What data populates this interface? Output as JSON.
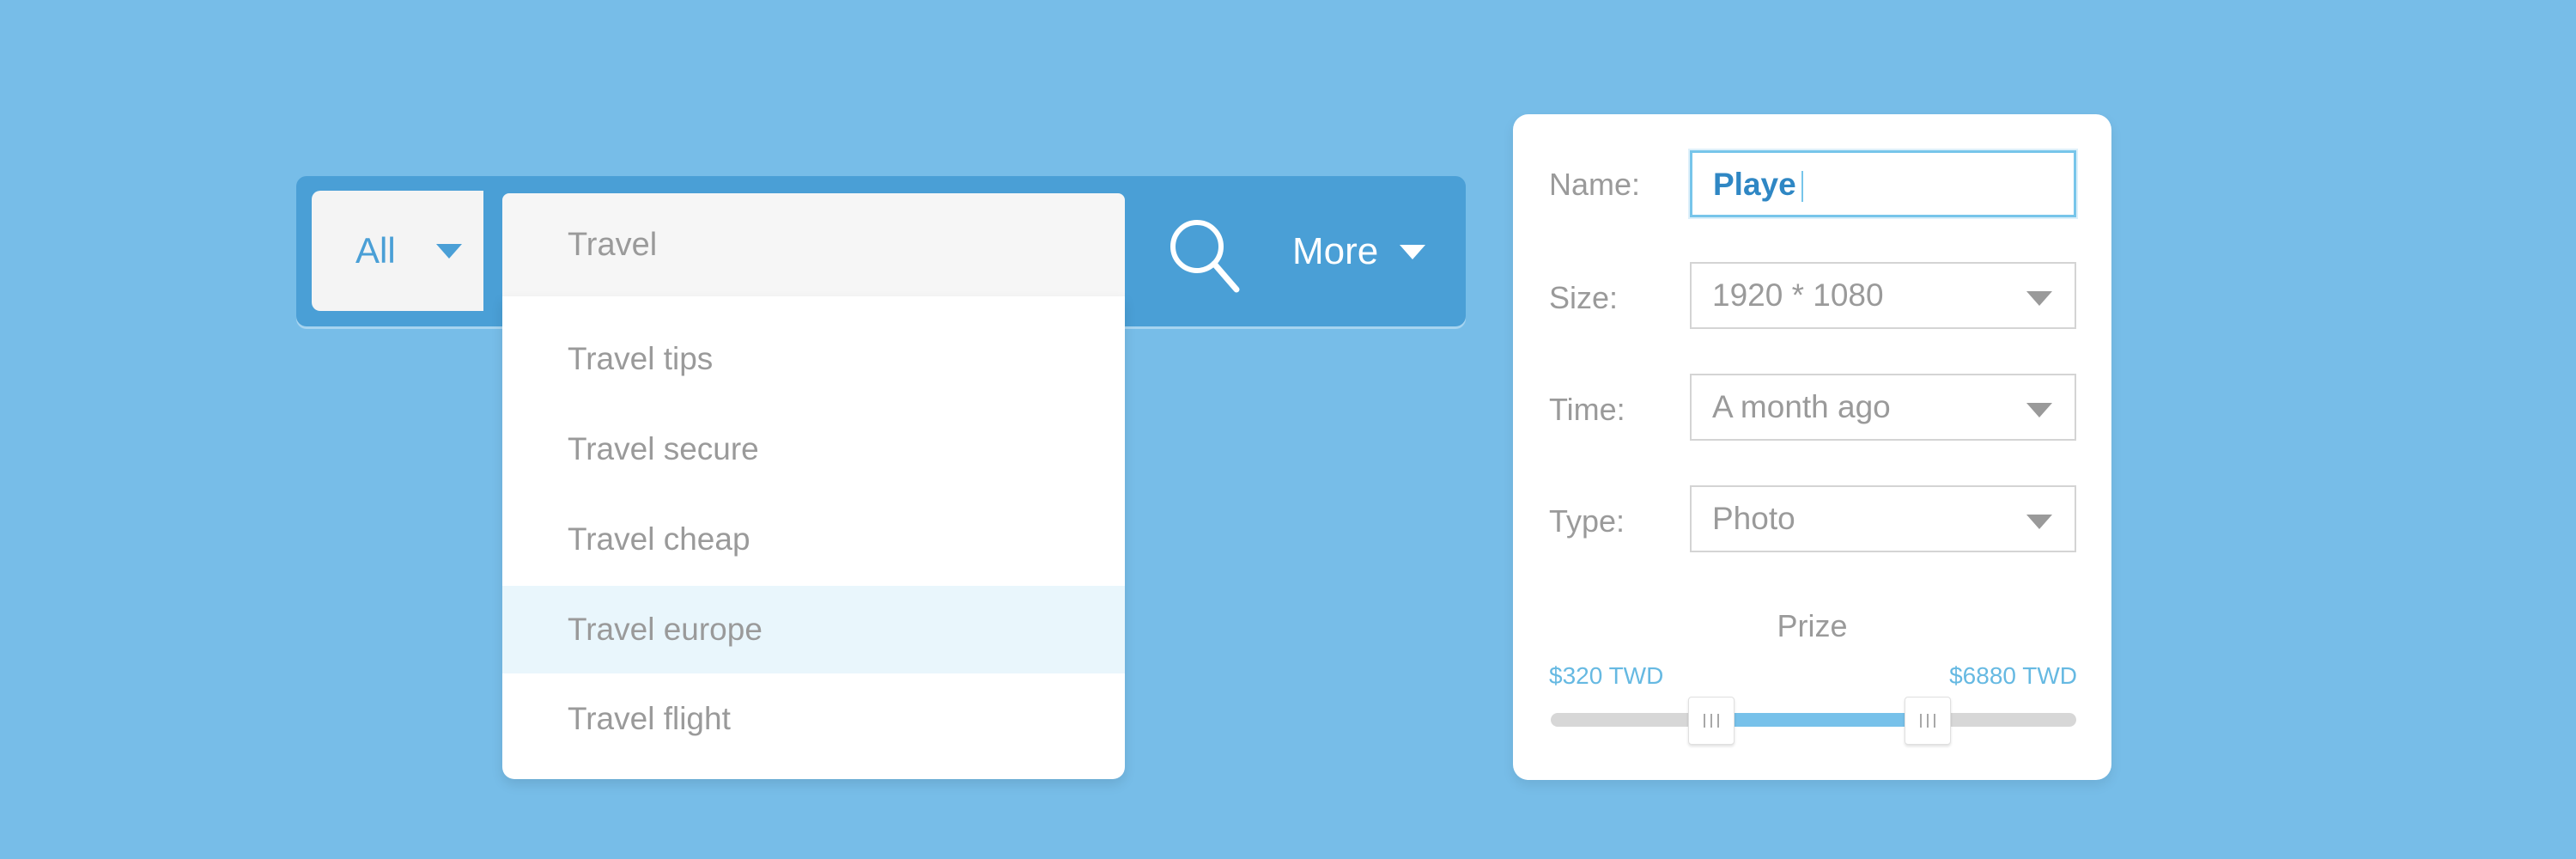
{
  "search": {
    "category": "All",
    "query": "Travel",
    "more_label": "More",
    "suggestions": [
      "Travel tips",
      "Travel secure",
      "Travel cheap",
      "Travel europe",
      "Travel flight"
    ],
    "highlighted_index": 3
  },
  "filters": {
    "name_label": "Name:",
    "name_value": "Playe",
    "size_label": "Size:",
    "size_value": "1920 * 1080",
    "time_label": "Time:",
    "time_value": "A month ago",
    "type_label": "Type:",
    "type_value": "Photo",
    "prize_title": "Prize",
    "prize_min": "$320 TWD",
    "prize_max": "$6880 TWD"
  },
  "colors": {
    "background": "#77bde8",
    "bar": "#4a9fd6",
    "accent": "#77c5ea",
    "highlight_row": "#e9f6fc"
  },
  "icons": [
    "chevron-down-icon",
    "search-icon"
  ]
}
